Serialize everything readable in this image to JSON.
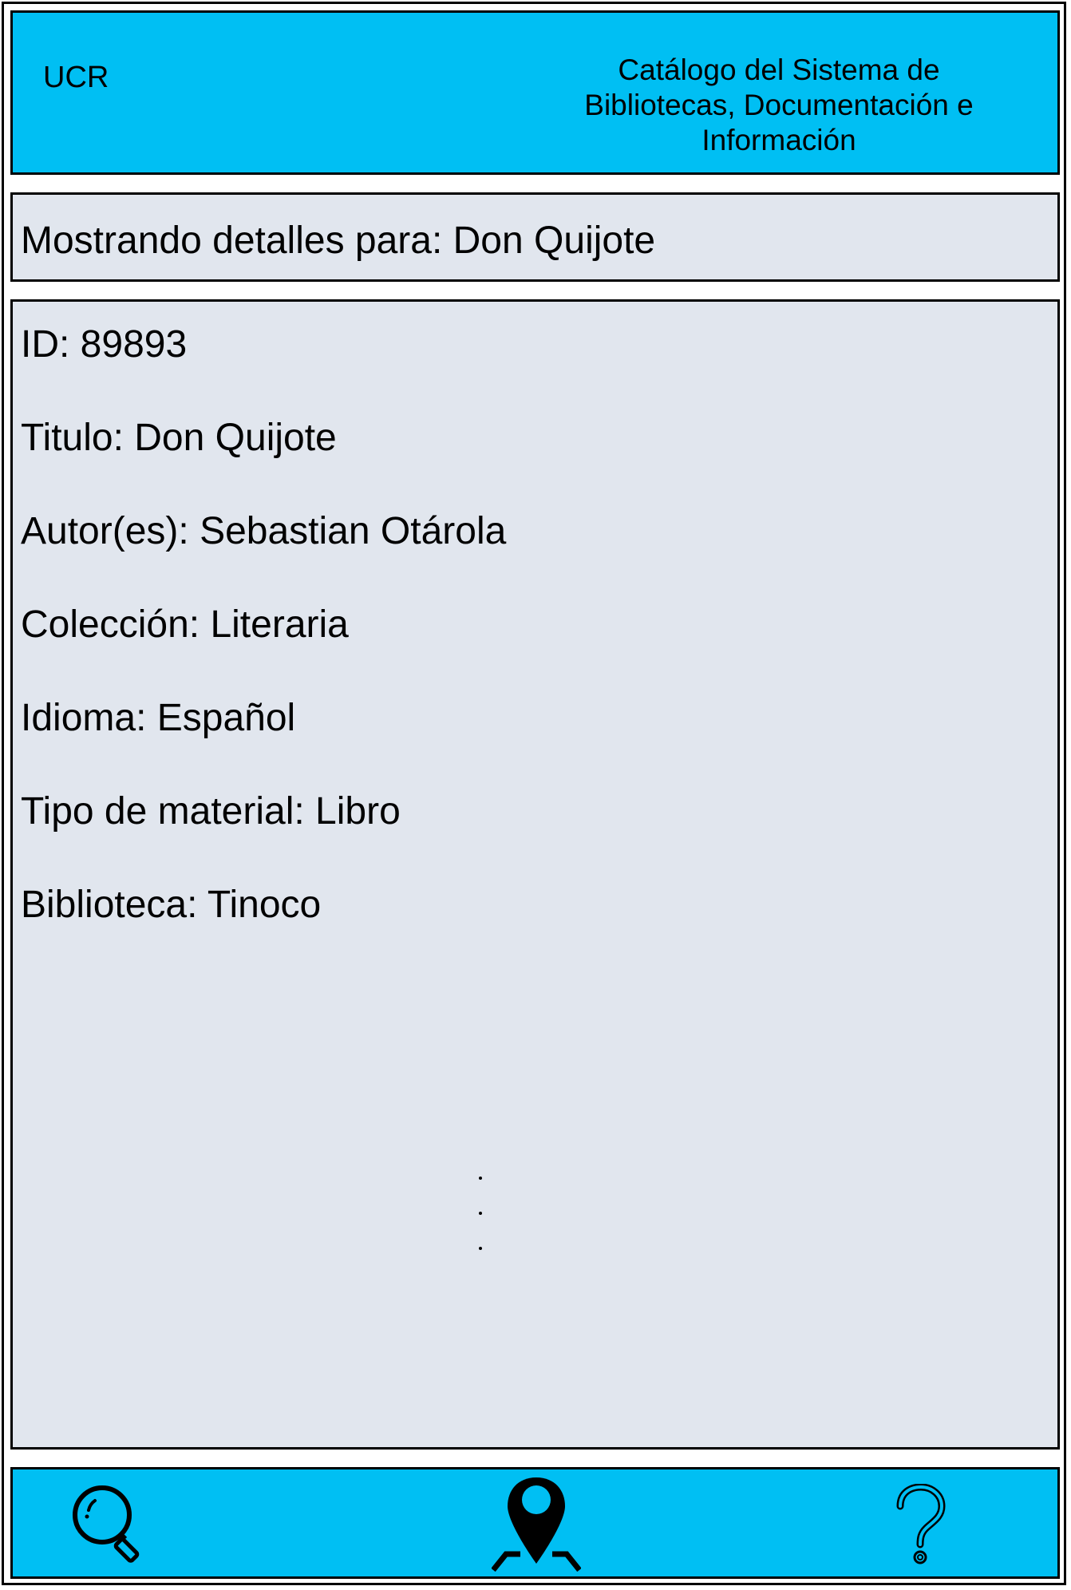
{
  "header": {
    "brand": "UCR",
    "title": "Catálogo del Sistema de Bibliotecas, Documentación e Información"
  },
  "summary": {
    "text": "Mostrando detalles para: Don Quijote"
  },
  "details": {
    "fields": [
      "ID: 89893",
      "Titulo: Don Quijote",
      "Autor(es): Sebastian Otárola",
      "Colección: Literaria",
      "Idioma: Español",
      "Tipo de material: Libro",
      "Biblioteca: Tinoco"
    ]
  },
  "footer": {
    "buttons": [
      {
        "icon": "search-icon"
      },
      {
        "icon": "map-pin-icon"
      },
      {
        "icon": "help-icon"
      }
    ]
  },
  "colors": {
    "bar": "#00bff3",
    "panel": "#e1e6ee",
    "border": "#000000"
  }
}
